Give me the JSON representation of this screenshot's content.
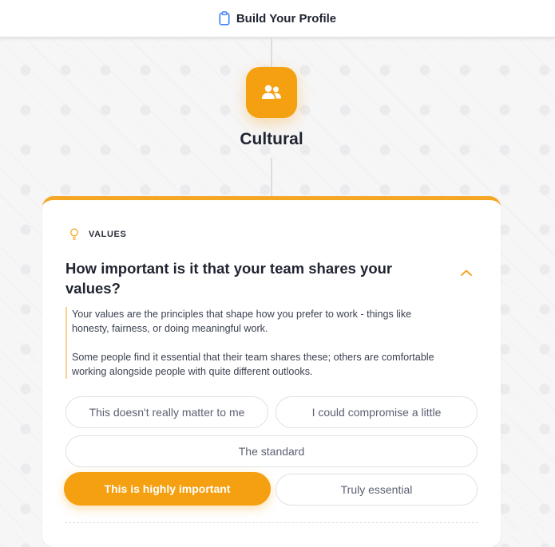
{
  "header": {
    "title": "Build Your Profile",
    "icon": "clipboard-icon"
  },
  "category": {
    "title": "Cultural",
    "icon": "users-icon",
    "accent": "#f5a010"
  },
  "card": {
    "tag": "VALUES",
    "tag_icon": "lightbulb-icon",
    "question": "How important is it that your team shares your values?",
    "description": [
      "Your values are the principles that shape how you prefer to work - things like honesty, fairness, or doing meaningful work.",
      "Some people find it essential that their team shares these; others are comfortable working alongside people with quite different outlooks."
    ],
    "options": [
      "This doesn't really matter to me",
      "I could compromise a little",
      "The standard",
      "This is highly important",
      "Truly essential"
    ],
    "selected": "This is highly important"
  }
}
